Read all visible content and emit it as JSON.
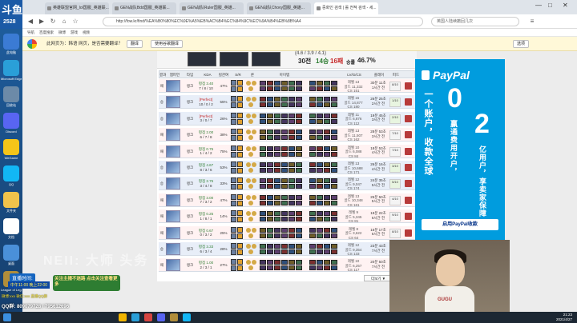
{
  "desktop": {
    "logo_top": "斗鱼",
    "logo_num": "2528",
    "icons": [
      {
        "label": "此电脑",
        "color": "#3b7bd4"
      },
      {
        "label": "Microsoft Edge",
        "color": "#2a9fd8"
      },
      {
        "label": "回收站",
        "color": "#6c8aa8"
      },
      {
        "label": "Discord",
        "color": "#5865f2"
      },
      {
        "label": "WeGame",
        "color": "#f5c518"
      },
      {
        "label": "QQ",
        "color": "#12b7f5"
      },
      {
        "label": "文件夹",
        "color": "#f1c34b"
      },
      {
        "label": "文档",
        "color": "#ffffff"
      },
      {
        "label": "桌面",
        "color": "#4a90d9"
      },
      {
        "label": "League of Legends",
        "color": "#b08d3a"
      }
    ]
  },
  "browser": {
    "tabs": [
      {
        "label": "英雄联盟官网_lol国服_英雄联..."
      },
      {
        "label": "GEN战队Bdd国服_英雄联..."
      },
      {
        "label": "GEN战队Ruler国服_英雄..."
      },
      {
        "label": "GEN战队Chovy国服_英雄..."
      },
      {
        "label": "중화인 검색 | 롤 전적 검색 - 세..."
      }
    ],
    "url": "http://fow.kr/find/%EA%B0%80%EC%9E%A5%EB%AC%B4%EC%84%9C%EC%9A%B4%EB%8B%A4",
    "search_placeholder": "英国人陆续撤回几次",
    "bookmarks": [
      "导航",
      "百度搜索",
      "微博",
      "游戏",
      "视频"
    ],
    "translate": {
      "text": "此网页为：韩语  网页，是否需要翻译？",
      "translate_btn": "翻译",
      "always_btn": "使用谷歌翻译",
      "close_btn": "选项"
    }
  },
  "summary": {
    "games": "30전",
    "wins": "14승",
    "losses": "16패",
    "winrate_label": "승률",
    "winrate": "46.7%",
    "kda_top": "(4.6 / 3.9 / 4.1)"
  },
  "table": {
    "headers": [
      "결과",
      "챔피언",
      "타입",
      "KDA",
      "킬관여",
      "S/R",
      "룬",
      "아이템",
      "LV/G/CS",
      "플레이",
      "피드",
      ""
    ],
    "rows": [
      {
        "result": "패",
        "type": "랭크",
        "kda": "평점 3.40",
        "kda2": "7 / 8 / 10",
        "pct": "47%",
        "lv": "레벨 13",
        "gold": "골드 11,332",
        "cs": "CS 151",
        "when": "30분 11초",
        "ago": "1시간 전",
        "score": "8/10",
        "outcome": "loss"
      },
      {
        "result": "승",
        "type": "랭크",
        "kda": "[Perfect]",
        "kda2": "10 / 0 / 2",
        "pct": "55%",
        "lv": "레벨 15",
        "gold": "골드 14,877",
        "cs": "CS 180",
        "when": "26분 25초",
        "ago": "2시간 전",
        "score": "1/10",
        "outcome": "win"
      },
      {
        "result": "승",
        "type": "랭크",
        "kda": "[Perfect]",
        "kda2": "3 / 0 / 7",
        "pct": "26%",
        "lv": "레벨 11",
        "gold": "골드 6,876",
        "cs": "CS 112",
        "when": "19분 45초",
        "ago": "3시간 전",
        "score": "2/10",
        "outcome": "win"
      },
      {
        "result": "패",
        "type": "랭크",
        "kda": "평점 2.00",
        "kda2": "6 / 7 / 8",
        "pct": "38%",
        "lv": "레벨 13",
        "gold": "골드 11,507",
        "cs": "CS 162",
        "when": "28분 53초",
        "ago": "3시간 전",
        "score": "7/10",
        "outcome": "loss"
      },
      {
        "result": "패",
        "type": "랭크",
        "kda": "평점 0.75",
        "kda2": "1 / 4 / 2",
        "pct": "75%",
        "lv": "레벨 10",
        "gold": "골드 6,088",
        "cs": "CS 84",
        "when": "18분 53초",
        "ago": "4시간 전",
        "score": "7/10",
        "outcome": "loss"
      },
      {
        "result": "승",
        "type": "랭크",
        "kda": "평점 4.67",
        "kda2": "8 / 3 / 6",
        "pct": "53%",
        "lv": "레벨 13",
        "gold": "골드 10,688",
        "cs": "CS 171",
        "when": "26분 16초",
        "ago": "4시간 전",
        "score": "3/10",
        "outcome": "win"
      },
      {
        "result": "승",
        "type": "랭크",
        "kda": "평점 2.75",
        "kda2": "3 / 4 / 8",
        "pct": "33%",
        "lv": "레벨 12",
        "gold": "골드 9,047",
        "cs": "CS 174",
        "when": "24분 35초",
        "ago": "5시간 전",
        "score": "5/10",
        "outcome": "win"
      },
      {
        "result": "패",
        "type": "랭크",
        "kda": "평점 3.00",
        "kda2": "7 / 3 / 2",
        "pct": "47%",
        "lv": "레벨 13",
        "gold": "골드 10,348",
        "cs": "CS 161",
        "when": "25분 50초",
        "ago": "5시간 전",
        "score": "4/10",
        "outcome": "loss"
      },
      {
        "result": "패",
        "type": "랭크",
        "kda": "평점 0.25",
        "kda2": "1 / 8 / 1",
        "pct": "14%",
        "lv": "레벨 9",
        "gold": "골드 5,345",
        "cs": "CS 81",
        "when": "19분 22초",
        "ago": "6시간 전",
        "score": "9/10",
        "outcome": "loss"
      },
      {
        "result": "패",
        "type": "랭크",
        "kda": "평점 0.67",
        "kda2": "0 / 3 / 2",
        "pct": "25%",
        "lv": "레벨 8",
        "gold": "골드 3,622",
        "cs": "CS 64",
        "when": "16분 17초",
        "ago": "6시간 전",
        "score": "8/10",
        "outcome": "loss"
      },
      {
        "result": "승",
        "type": "랭크",
        "kda": "평점 3.33",
        "kda2": "6 / 3 / 4",
        "pct": "28%",
        "lv": "레벨 12",
        "gold": "골드 9,354",
        "cs": "CS 133",
        "when": "23분 43초",
        "ago": "7시간 전",
        "score": "2/10",
        "outcome": "win"
      },
      {
        "result": "패",
        "type": "랭크",
        "kda": "평점 1.00",
        "kda2": "2 / 3 / 1",
        "pct": "27%",
        "lv": "레벨 10",
        "gold": "골드 6,257",
        "cs": "CS 117",
        "when": "20분 50초",
        "ago": "7시간 전",
        "score": "6/10",
        "outcome": "loss"
      }
    ],
    "more": "더보기 ▼"
  },
  "ad": {
    "brand": "PayPal",
    "line1": "一个账户，收款全球",
    "big1": "0",
    "text1": "赢通费用开户，",
    "big2": "2",
    "text2": "亿用户，享卖家保障",
    "cta": "启用PayPal收款"
  },
  "stream": {
    "live_label": "直播时间:",
    "live_time": "中午11:00 晚上22:00",
    "follow": "关注主播不迷路 点击关注查看更多",
    "info_line": "微博:xxx 微信:xxx 直播QQ群",
    "qq": "QQ群: 809079728 / 795612696",
    "watermark": "NEII: 大师 头务",
    "shirt": "GUGU"
  },
  "taskbar": {
    "time": "21:23",
    "date": "2021/4/27"
  }
}
